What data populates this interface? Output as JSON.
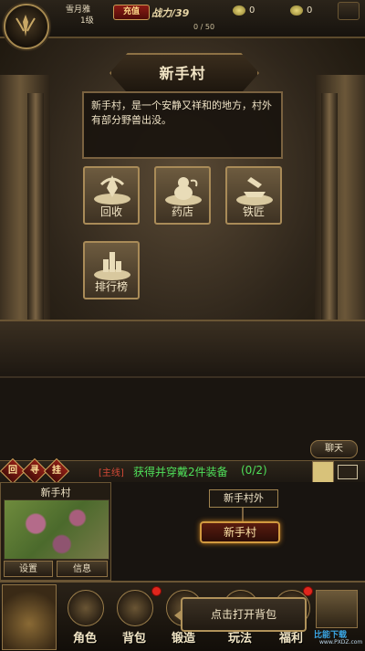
{
  "header": {
    "player_name": "雪月雅",
    "level": "1级",
    "recharge_label": "充值",
    "power_text": "战力/39",
    "exp_text": "0 / 50",
    "currency1": "0",
    "currency2": "0"
  },
  "scene": {
    "title": "新手村",
    "description": "新手村，是一个安静又祥和的地方，村外有部分野兽出没。",
    "npcs": [
      {
        "label": "回收",
        "icon": "recycle-icon"
      },
      {
        "label": "药店",
        "icon": "gourd-icon"
      },
      {
        "label": "铁匠",
        "icon": "anvil-icon"
      },
      {
        "label": "排行榜",
        "icon": "ranking-icon"
      }
    ]
  },
  "chat": {
    "button_label": "聊天"
  },
  "quest": {
    "icons": [
      "回",
      "寻",
      "挂"
    ],
    "tag": "[主线]",
    "text": "获得并穿戴2件装备",
    "progress": "(0/2)"
  },
  "map": {
    "title": "新手村",
    "settings_label": "设置",
    "info_label": "信息"
  },
  "locations": {
    "outer": "新手村外",
    "current": "新手村"
  },
  "nav": {
    "items": [
      {
        "label": "角色"
      },
      {
        "label": "背包"
      },
      {
        "label": "锻造"
      },
      {
        "label": "玩法"
      },
      {
        "label": "福利"
      }
    ],
    "tooltip": "点击打开背包"
  },
  "watermark": {
    "brand": "比能下载",
    "domain": "www.PXDZ.com"
  },
  "colors": {
    "quest_green": "#4fe05a",
    "quest_tag_red": "#d64a37",
    "gold_border": "#a98b58"
  }
}
